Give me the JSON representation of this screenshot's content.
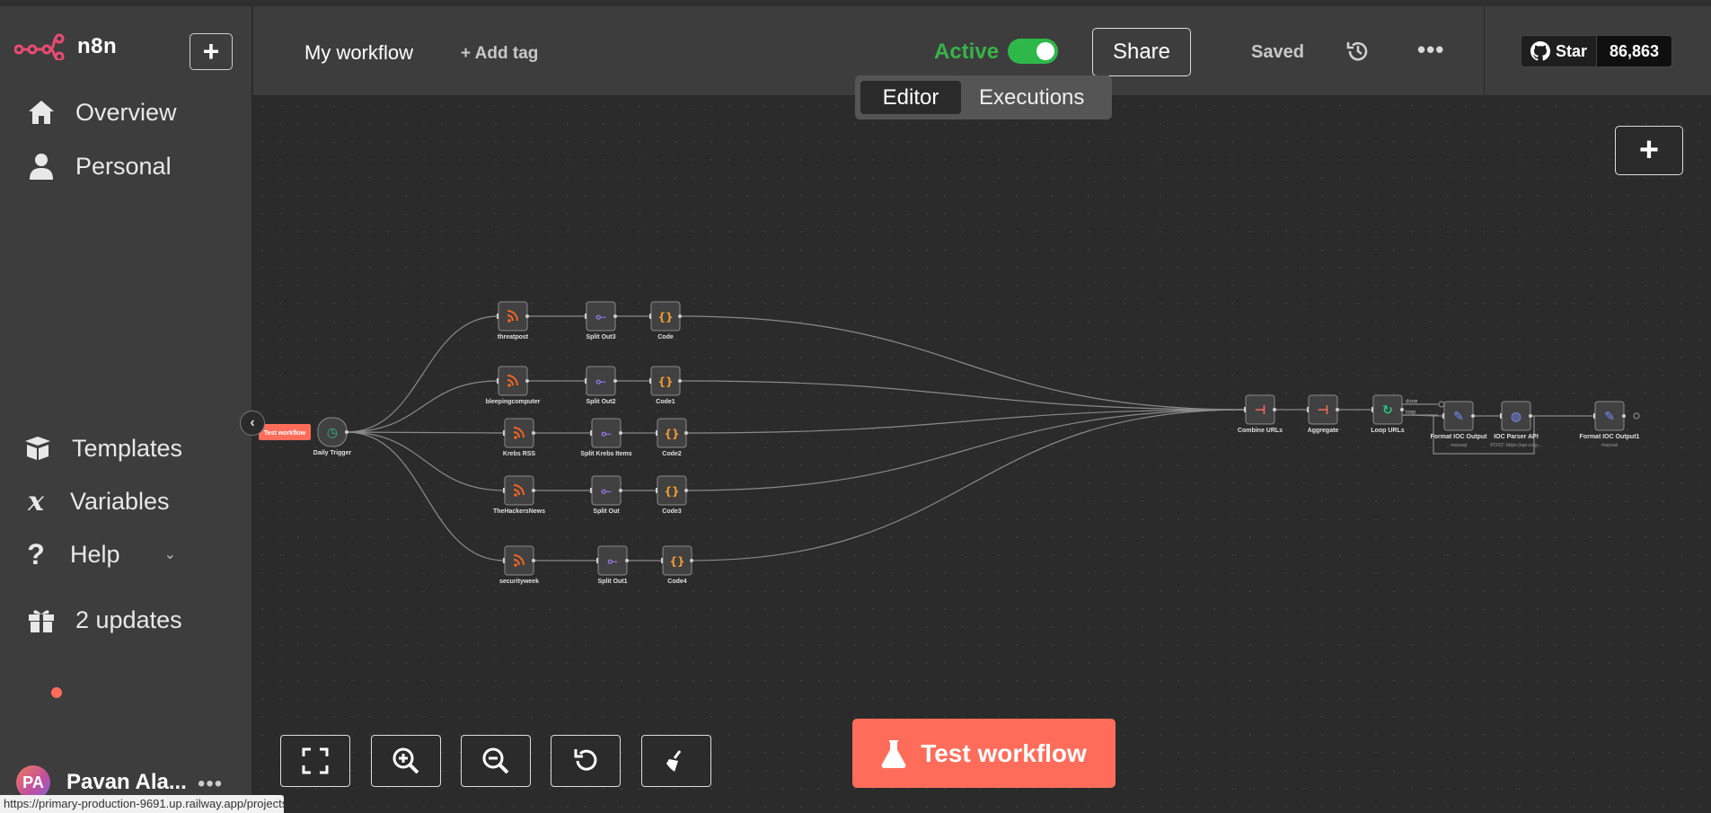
{
  "app": {
    "name": "n8n"
  },
  "sidebar": {
    "items": [
      {
        "label": "Overview",
        "icon": "home-icon"
      },
      {
        "label": "Personal",
        "icon": "user-icon"
      }
    ],
    "bottom_items": [
      {
        "label": "Templates",
        "icon": "box-icon"
      },
      {
        "label": "Variables",
        "icon": "variable-icon"
      },
      {
        "label": "Help",
        "icon": "help-icon"
      },
      {
        "label": "2 updates",
        "icon": "gift-icon"
      }
    ],
    "user": {
      "initials": "PA",
      "name": "Pavan Ala..."
    }
  },
  "header": {
    "workflow_name": "My workflow",
    "add_tag": "+ Add tag",
    "active_label": "Active",
    "share_label": "Share",
    "saved_label": "Saved",
    "github": {
      "star_label": "Star",
      "count": "86,863"
    },
    "tabs": [
      {
        "label": "Editor",
        "active": true
      },
      {
        "label": "Executions",
        "active": false
      }
    ]
  },
  "canvas": {
    "trigger_badge": "Test workflow",
    "nodes": [
      {
        "id": "daily",
        "label": "Daily Trigger",
        "kind": "trigger"
      },
      {
        "id": "threatpost",
        "label": "threatpost",
        "kind": "rss"
      },
      {
        "id": "split3",
        "label": "Split Out3",
        "kind": "split"
      },
      {
        "id": "code",
        "label": "Code",
        "kind": "code"
      },
      {
        "id": "bleeping",
        "label": "bleepingcomputer",
        "kind": "rss"
      },
      {
        "id": "split2",
        "label": "Split Out2",
        "kind": "split"
      },
      {
        "id": "code1",
        "label": "Code1",
        "kind": "code"
      },
      {
        "id": "krebs",
        "label": "Krebs RSS",
        "kind": "rss"
      },
      {
        "id": "splitkrebs",
        "label": "Split Krebs Items",
        "kind": "split"
      },
      {
        "id": "code2",
        "label": "Code2",
        "kind": "code"
      },
      {
        "id": "thn",
        "label": "TheHackersNews",
        "kind": "rss"
      },
      {
        "id": "split",
        "label": "Split Out",
        "kind": "split"
      },
      {
        "id": "code3",
        "label": "Code3",
        "kind": "code"
      },
      {
        "id": "secweek",
        "label": "securityweek",
        "kind": "rss"
      },
      {
        "id": "split1",
        "label": "Split Out1",
        "kind": "split"
      },
      {
        "id": "code4",
        "label": "Code4",
        "kind": "code"
      },
      {
        "id": "combine",
        "label": "Combine URLs",
        "kind": "merge"
      },
      {
        "id": "aggregate",
        "label": "Aggregate",
        "kind": "merge"
      },
      {
        "id": "loop",
        "label": "Loop URLs",
        "kind": "loop"
      },
      {
        "id": "format",
        "label": "Format IOC Output",
        "sub": "manual",
        "kind": "edit"
      },
      {
        "id": "ioc",
        "label": "IOC Parser API",
        "sub": "POST: https://api.iocp...",
        "kind": "http"
      },
      {
        "id": "format1",
        "label": "Format IOC Output1",
        "sub": "manual",
        "kind": "edit"
      }
    ],
    "loop_outputs": [
      "done",
      "loop"
    ]
  },
  "toolbar": {
    "test_label": "Test workflow",
    "buttons": [
      "fit-view-button",
      "zoom-in-button",
      "zoom-out-button",
      "reset-zoom-button",
      "tidy-up-button"
    ]
  },
  "status_url": "https://primary-production-9691.up.railway.app/projects"
}
